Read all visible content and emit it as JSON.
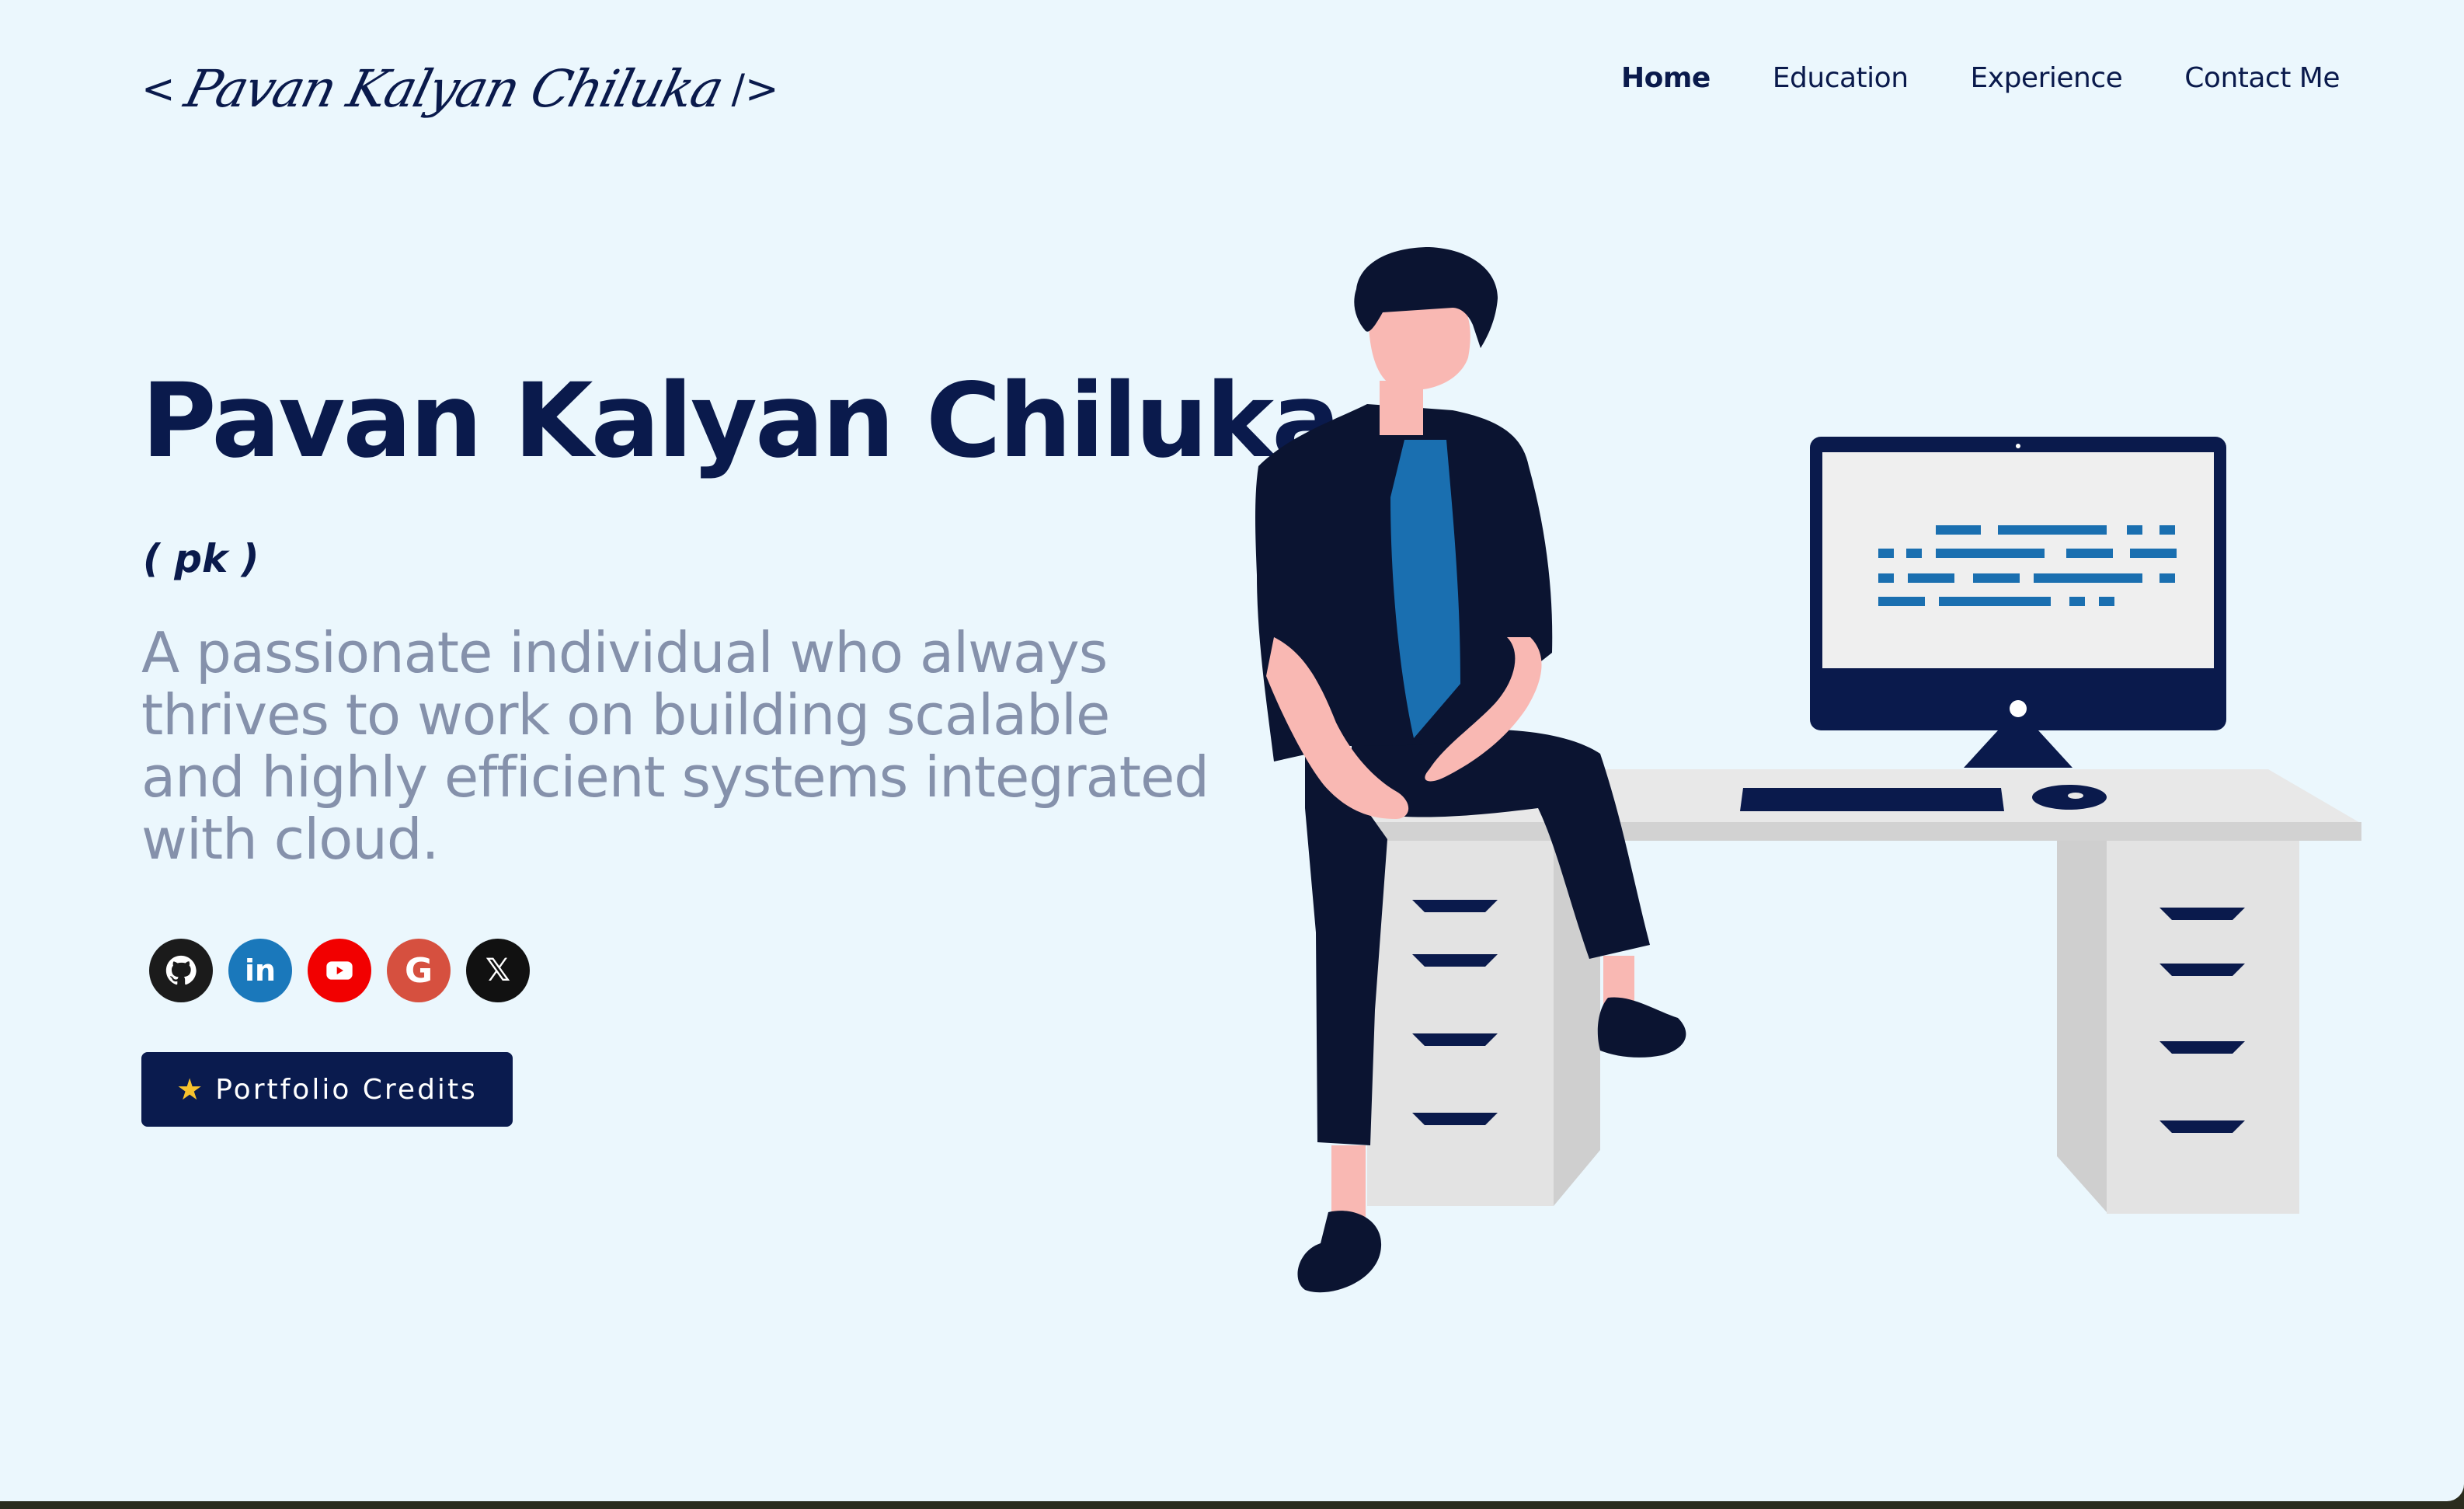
{
  "header": {
    "logo": {
      "open": "<",
      "signature": "Pavan Kalyan Chiluka",
      "close": "/>"
    },
    "nav": [
      {
        "label": "Home",
        "active": true
      },
      {
        "label": "Education",
        "active": false
      },
      {
        "label": "Experience",
        "active": false
      },
      {
        "label": "Contact Me",
        "active": false
      }
    ]
  },
  "hero": {
    "name": "Pavan Kalyan Chiluka",
    "nickname": "( pk )",
    "tagline": "A passionate individual who always thrives to work on building scalable and highly efficient systems integrated with cloud.",
    "socials": [
      {
        "icon": "github-icon",
        "glyph": ""
      },
      {
        "icon": "linkedin-icon",
        "glyph": "in"
      },
      {
        "icon": "youtube-icon",
        "glyph": ""
      },
      {
        "icon": "google-icon",
        "glyph": "G"
      },
      {
        "icon": "x-icon",
        "glyph": "𝕏"
      }
    ],
    "credits_button": {
      "icon": "★",
      "label": "Portfolio Credits"
    }
  },
  "colors": {
    "background": "#ebf7fd",
    "primary": "#0a1a4c",
    "muted_text": "#8591ab",
    "github": "#1b1b1b",
    "linkedin": "#1a78bb",
    "youtube": "#f20000",
    "google": "#d6503f",
    "x": "#111111"
  }
}
